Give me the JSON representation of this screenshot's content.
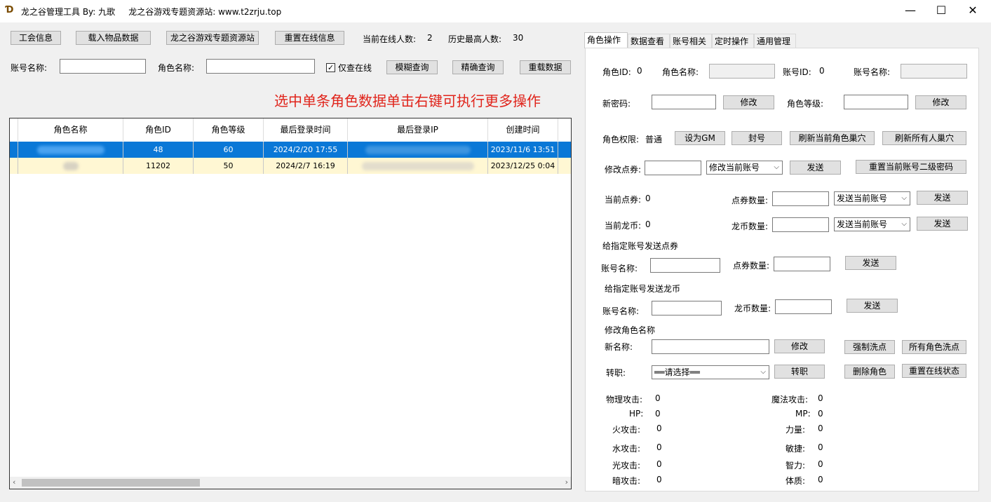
{
  "window": {
    "title": "龙之谷管理工具 By: 九歌     龙之谷游戏专题资源站: www.t2zrju.top",
    "minimize": "—",
    "maximize": "☐",
    "close": "✕"
  },
  "toolbar": {
    "guild_info": "工会信息",
    "load_items": "载入物品数据",
    "resource_site": "龙之谷游戏专题资源站",
    "reset_online": "重置在线信息",
    "online_label": "当前在线人数:",
    "online_value": "2",
    "max_label": "历史最高人数:",
    "max_value": "30"
  },
  "search": {
    "account_label": "账号名称:",
    "role_label": "角色名称:",
    "only_online": "仅查在线",
    "only_online_checked": "✓",
    "fuzzy": "模糊查询",
    "exact": "精确查询",
    "reload": "重载数据"
  },
  "hint": "选中单条角色数据单击右键可执行更多操作",
  "table": {
    "headers": [
      "角色名称",
      "角色ID",
      "角色等级",
      "最后登录时间",
      "最后登录IP",
      "创建时间"
    ],
    "rows": [
      {
        "name": "",
        "id": "48",
        "level": "60",
        "last_login": "2024/2/20 17:55",
        "ip": "",
        "created": "2023/11/6 13:51"
      },
      {
        "name": "",
        "id": "11202",
        "level": "50",
        "last_login": "2024/2/7 16:19",
        "ip": "",
        "created": "2023/12/25 0:04"
      }
    ]
  },
  "tabs": [
    "角色操作",
    "数据查看",
    "账号相关",
    "定时操作",
    "通用管理"
  ],
  "panel": {
    "role_id_label": "角色ID:",
    "role_id_value": "0",
    "role_name_label": "角色名称:",
    "account_id_label": "账号ID:",
    "account_id_value": "0",
    "account_name_label": "账号名称:",
    "new_password_label": "新密码:",
    "modify": "修改",
    "role_level_label": "角色等级:",
    "permission_label": "角色权限:",
    "permission_value": "普通",
    "set_gm": "设为GM",
    "ban": "封号",
    "refresh_current_nest": "刷新当前角色巢穴",
    "refresh_all_nest": "刷新所有人巢穴",
    "modify_points_label": "修改点券:",
    "modify_points_select": "修改当前账号",
    "send": "发送",
    "reset_second_pwd": "重置当前账号二级密码",
    "current_points_label": "当前点券:",
    "current_points_value": "0",
    "points_amount_label": "点券数量:",
    "send_current_account": "发送当前账号",
    "current_dragon_label": "当前龙币:",
    "current_dragon_value": "0",
    "dragon_amount_label": "龙币数量:",
    "send_points_title": "给指定账号发送点券",
    "account_name_label2": "账号名称:",
    "send_dragon_title": "给指定账号发送龙币",
    "rename_title": "修改角色名称",
    "new_name_label": "新名称:",
    "force_wash": "强制洗点",
    "all_wash": "所有角色洗点",
    "job_change_label": "转职:",
    "job_select": "══请选择══",
    "job_change": "转职",
    "delete_role": "删除角色",
    "reset_online_state": "重置在线状态",
    "stats": {
      "phys_atk": "物理攻击:",
      "phys_atk_v": "0",
      "magic_atk": "魔法攻击:",
      "magic_atk_v": "0",
      "hp": "HP:",
      "hp_v": "0",
      "mp": "MP:",
      "mp_v": "0",
      "fire": "火攻击:",
      "fire_v": "0",
      "str": "力量:",
      "str_v": "0",
      "water": "水攻击:",
      "water_v": "0",
      "agi": "敏捷:",
      "agi_v": "0",
      "light": "光攻击:",
      "light_v": "0",
      "int": "智力:",
      "int_v": "0",
      "dark": "暗攻击:",
      "dark_v": "0",
      "vit": "体质:",
      "vit_v": "0"
    }
  }
}
